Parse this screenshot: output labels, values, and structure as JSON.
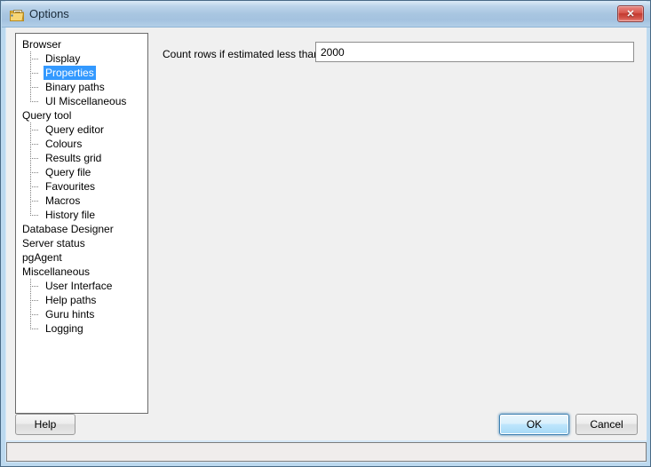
{
  "window": {
    "title": "Options",
    "icon": "options-properties-icon",
    "close_label": "✕",
    "colors": {
      "titlebar_top": "#d8e7f4",
      "titlebar_bottom": "#b3cfe8",
      "frame": "#bcd9ef",
      "selection": "#3399ff",
      "close_button": "#c2392f",
      "client_bg": "#f0f0f0"
    }
  },
  "tree": {
    "selected": "Properties",
    "items": [
      {
        "label": "Browser",
        "level": 0,
        "last": false
      },
      {
        "label": "Display",
        "level": 1,
        "last": false
      },
      {
        "label": "Properties",
        "level": 1,
        "last": false
      },
      {
        "label": "Binary paths",
        "level": 1,
        "last": false
      },
      {
        "label": "UI Miscellaneous",
        "level": 1,
        "last": true
      },
      {
        "label": "Query tool",
        "level": 0,
        "last": false
      },
      {
        "label": "Query editor",
        "level": 1,
        "last": false
      },
      {
        "label": "Colours",
        "level": 1,
        "last": false
      },
      {
        "label": "Results grid",
        "level": 1,
        "last": false
      },
      {
        "label": "Query file",
        "level": 1,
        "last": false
      },
      {
        "label": "Favourites",
        "level": 1,
        "last": false
      },
      {
        "label": "Macros",
        "level": 1,
        "last": false
      },
      {
        "label": "History file",
        "level": 1,
        "last": true
      },
      {
        "label": "Database Designer",
        "level": 0,
        "last": false
      },
      {
        "label": "Server status",
        "level": 0,
        "last": false
      },
      {
        "label": "pgAgent",
        "level": 0,
        "last": false
      },
      {
        "label": "Miscellaneous",
        "level": 0,
        "last": false
      },
      {
        "label": "User Interface",
        "level": 1,
        "last": false
      },
      {
        "label": "Help paths",
        "level": 1,
        "last": false
      },
      {
        "label": "Guru hints",
        "level": 1,
        "last": false
      },
      {
        "label": "Logging",
        "level": 1,
        "last": true
      }
    ]
  },
  "settings": {
    "row_count": {
      "label": "Count rows if estimated less than",
      "value": "2000",
      "placeholder": ""
    }
  },
  "buttons": {
    "help": "Help",
    "ok": "OK",
    "cancel": "Cancel"
  },
  "status_bar": {
    "text": ""
  }
}
